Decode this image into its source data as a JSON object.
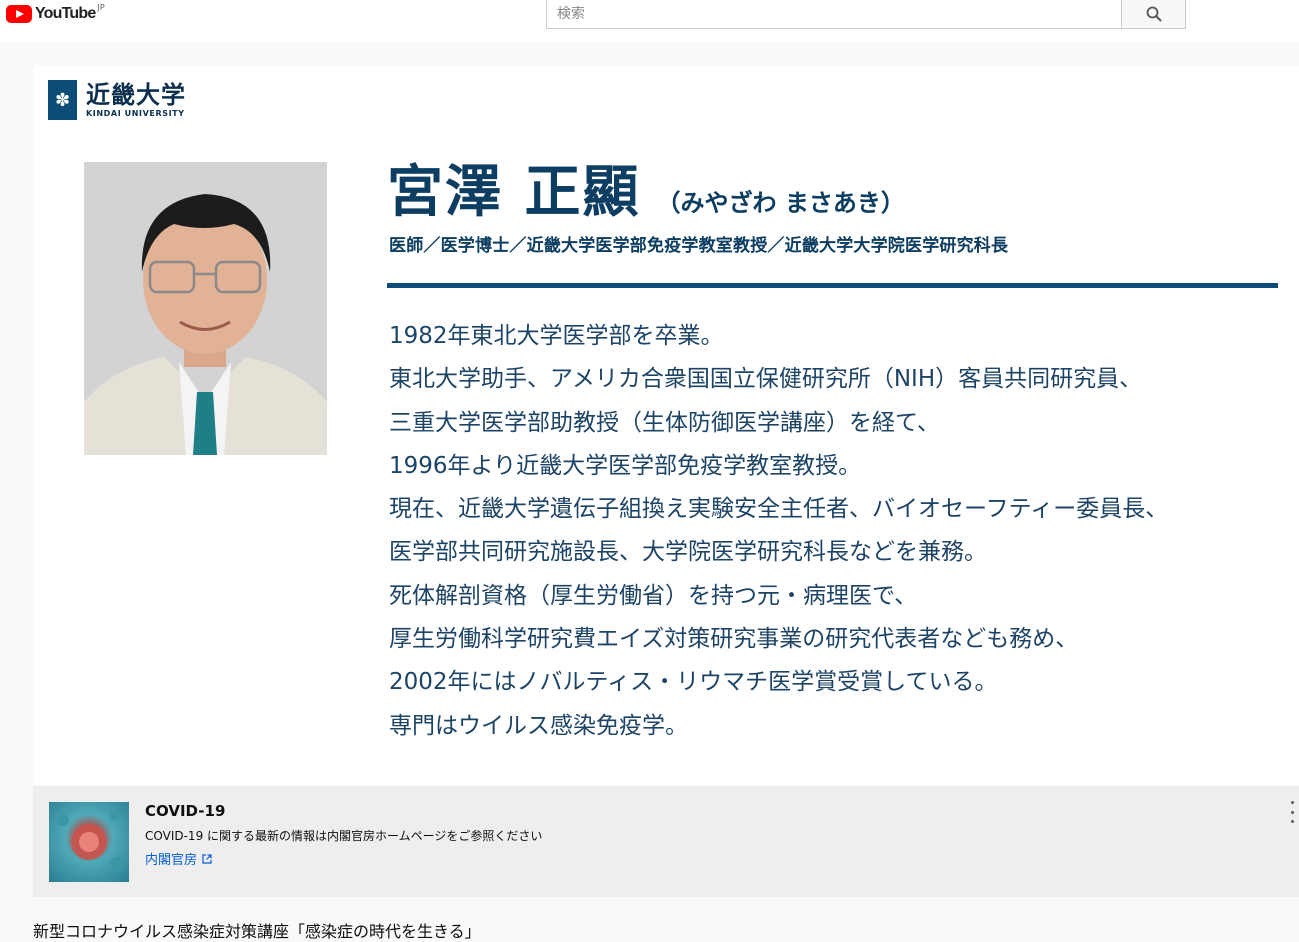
{
  "header": {
    "logo_text": "YouTube",
    "region": "JP",
    "search_placeholder": "検索"
  },
  "video": {
    "university": {
      "name_jp": "近畿大学",
      "name_en": "KINDAI UNIVERSITY"
    },
    "lecturer": {
      "name": "宮澤 正顯",
      "kana": "（みやざわ まさあき）",
      "titles": "医師／医学博士／近畿大学医学部免疫学教室教授／近畿大学大学院医学研究科長"
    },
    "bio": [
      "1982年東北大学医学部を卒業。",
      "東北大学助手、アメリカ合衆国国立保健研究所（NIH）客員共同研究員、",
      "三重大学医学部助教授（生体防御医学講座）を経て、",
      "1996年より近畿大学医学部免疫学教室教授。",
      "現在、近畿大学遺伝子組換え実験安全主任者、バイオセーフティー委員長、",
      "医学部共同研究施設長、大学院医学研究科長などを兼務。",
      "死体解剖資格（厚生労働省）を持つ元・病理医で、",
      "厚生労働科学研究費エイズ対策研究事業の研究代表者なども務め、",
      "2002年にはノバルティス・リウマチ医学賞受賞している。",
      "専門はウイルス感染免疫学。"
    ]
  },
  "info_panel": {
    "title": "COVID-19",
    "description": "COVID-19 に関する最新の情報は内閣官房ホームページをご参照ください",
    "link_text": "内閣官房"
  },
  "video_title": "新型コロナウイルス感染症対策講座「感染症の時代を生きる」",
  "colors": {
    "brand_red": "#ff0000",
    "kindai_navy": "#0d4d78",
    "link_blue": "#065fd4"
  }
}
